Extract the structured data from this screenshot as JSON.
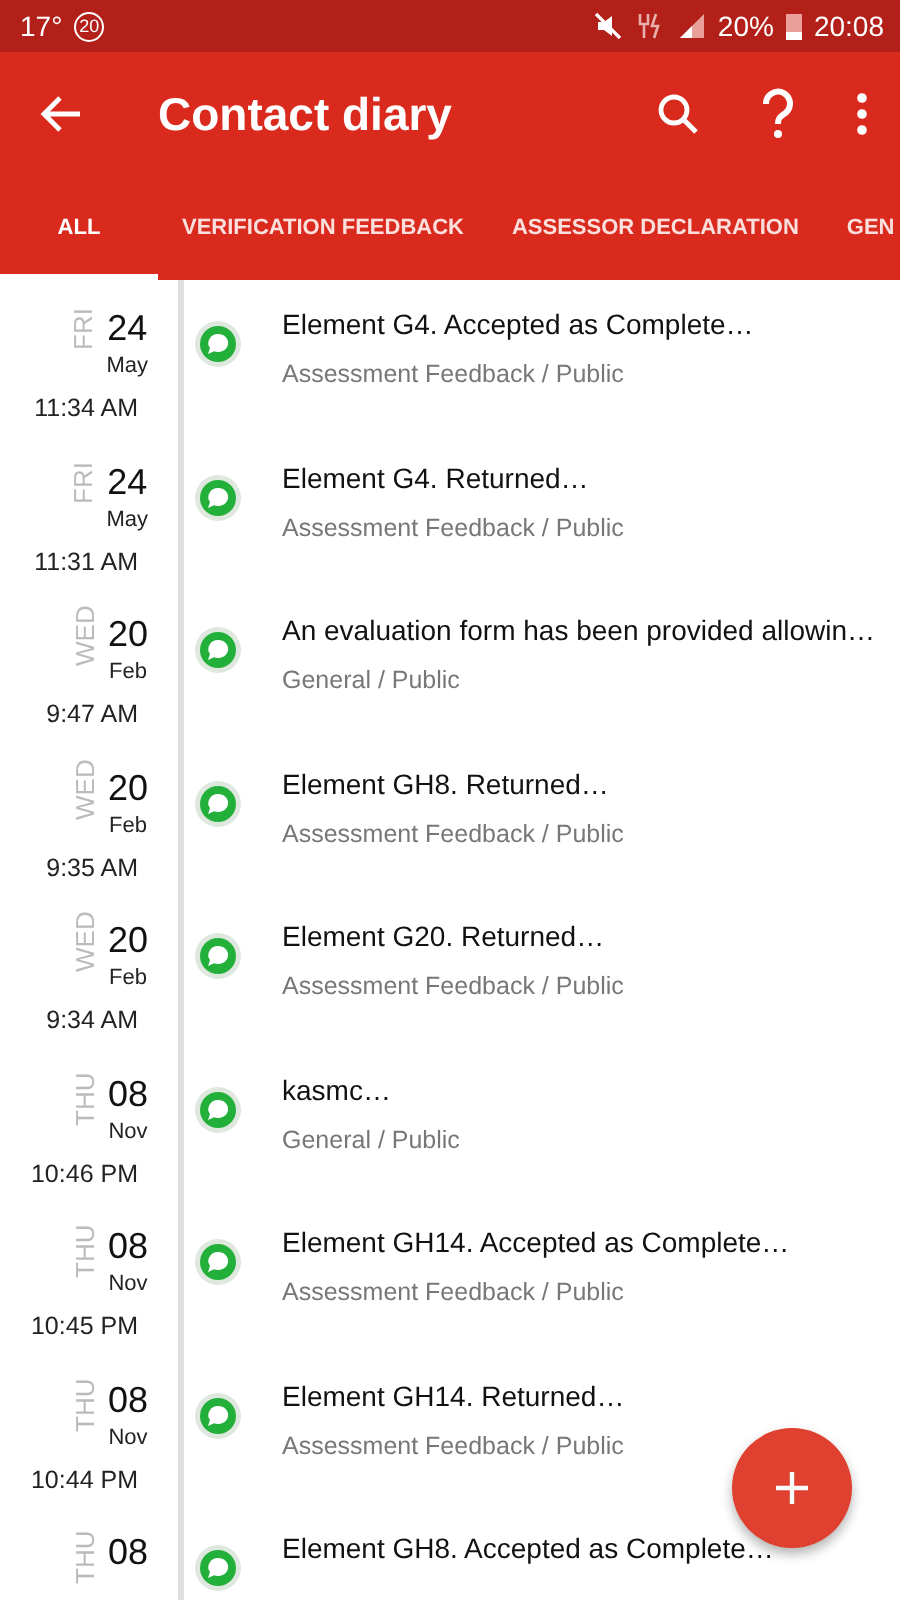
{
  "status_bar": {
    "temperature": "17°",
    "badge": "20",
    "battery": "20%",
    "time": "20:08"
  },
  "app_bar": {
    "title": "Contact diary"
  },
  "tabs": [
    {
      "label": "ALL",
      "selected": true
    },
    {
      "label": "VERIFICATION FEEDBACK",
      "selected": false
    },
    {
      "label": "ASSESSOR DECLARATION",
      "selected": false
    },
    {
      "label": "GEN",
      "selected": false
    }
  ],
  "entries": [
    {
      "day": "FRI",
      "date": "24",
      "month": "May",
      "time": "11:34 AM",
      "title": "Element G4. Accepted as Complete…",
      "category": "Assessment Feedback / Public"
    },
    {
      "day": "FRI",
      "date": "24",
      "month": "May",
      "time": "11:31 AM",
      "title": "Element G4. Returned…",
      "category": "Assessment Feedback / Public"
    },
    {
      "day": "WED",
      "date": "20",
      "month": "Feb",
      "time": "9:47 AM",
      "title": "An evaluation form has been provided allowin…",
      "category": "General / Public"
    },
    {
      "day": "WED",
      "date": "20",
      "month": "Feb",
      "time": "9:35 AM",
      "title": "Element GH8. Returned…",
      "category": "Assessment Feedback / Public"
    },
    {
      "day": "WED",
      "date": "20",
      "month": "Feb",
      "time": "9:34 AM",
      "title": "Element G20. Returned…",
      "category": "Assessment Feedback / Public"
    },
    {
      "day": "THU",
      "date": "08",
      "month": "Nov",
      "time": "10:46 PM",
      "title": "kasmc…",
      "category": "General / Public"
    },
    {
      "day": "THU",
      "date": "08",
      "month": "Nov",
      "time": "10:45 PM",
      "title": "Element GH14. Accepted as Complete…",
      "category": "Assessment Feedback / Public"
    },
    {
      "day": "THU",
      "date": "08",
      "month": "Nov",
      "time": "10:44 PM",
      "title": "Element GH14. Returned…",
      "category": "Assessment Feedback / Public"
    },
    {
      "day": "THU",
      "date": "08",
      "title": "Element GH8. Accepted as Complete…"
    }
  ]
}
